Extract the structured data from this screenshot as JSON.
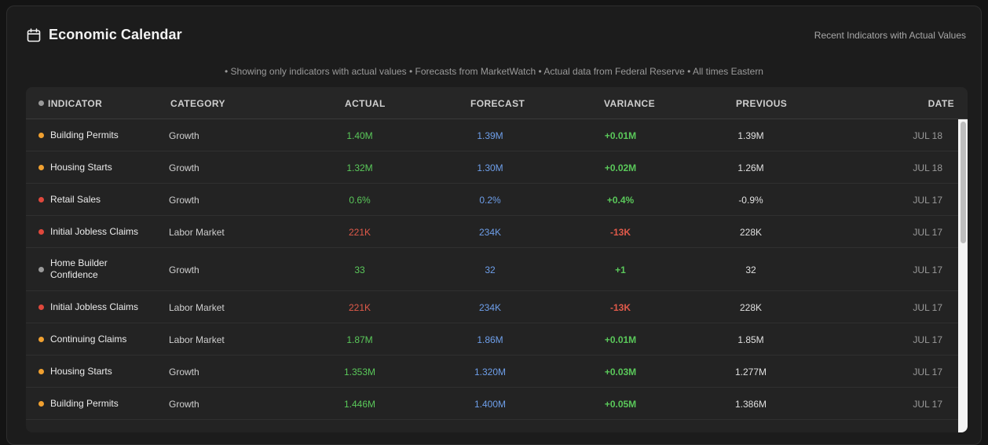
{
  "header": {
    "title": "Economic Calendar",
    "right_text": "Recent Indicators with Actual Values",
    "icon": "calendar-icon"
  },
  "subtitle": "• Showing only indicators with actual values • Forecasts from MarketWatch • Actual data from Federal Reserve • All times Eastern",
  "columns": {
    "indicator": "INDICATOR",
    "category": "CATEGORY",
    "actual": "ACTUAL",
    "forecast": "FORECAST",
    "variance": "VARIANCE",
    "previous": "PREVIOUS",
    "date": "DATE"
  },
  "colors": {
    "positive": "#5ac85a",
    "negative": "#e05a4a",
    "forecast": "#6e9fea",
    "dot_orange": "#f0a030",
    "dot_red": "#e0483c",
    "dot_gray": "#9a9a9a"
  },
  "rows": [
    {
      "indicator": "Building Permits",
      "dot": "orange",
      "category": "Growth",
      "actual": "1.40M",
      "actual_sign": "pos",
      "forecast": "1.39M",
      "variance": "+0.01M",
      "variance_sign": "pos",
      "previous": "1.39M",
      "date": "JUL 18"
    },
    {
      "indicator": "Housing Starts",
      "dot": "orange",
      "category": "Growth",
      "actual": "1.32M",
      "actual_sign": "pos",
      "forecast": "1.30M",
      "variance": "+0.02M",
      "variance_sign": "pos",
      "previous": "1.26M",
      "date": "JUL 18"
    },
    {
      "indicator": "Retail Sales",
      "dot": "red",
      "category": "Growth",
      "actual": "0.6%",
      "actual_sign": "pos",
      "forecast": "0.2%",
      "variance": "+0.4%",
      "variance_sign": "pos",
      "previous": "-0.9%",
      "date": "JUL 17"
    },
    {
      "indicator": "Initial Jobless Claims",
      "dot": "red",
      "category": "Labor Market",
      "actual": "221K",
      "actual_sign": "neg",
      "forecast": "234K",
      "variance": "-13K",
      "variance_sign": "neg",
      "previous": "228K",
      "date": "JUL 17"
    },
    {
      "indicator": "Home Builder Confidence",
      "dot": "gray",
      "category": "Growth",
      "actual": "33",
      "actual_sign": "pos",
      "forecast": "32",
      "variance": "+1",
      "variance_sign": "pos",
      "previous": "32",
      "date": "JUL 17",
      "tall": true
    },
    {
      "indicator": "Initial Jobless Claims",
      "dot": "red",
      "category": "Labor Market",
      "actual": "221K",
      "actual_sign": "neg",
      "forecast": "234K",
      "variance": "-13K",
      "variance_sign": "neg",
      "previous": "228K",
      "date": "JUL 17"
    },
    {
      "indicator": "Continuing Claims",
      "dot": "orange",
      "category": "Labor Market",
      "actual": "1.87M",
      "actual_sign": "pos",
      "forecast": "1.86M",
      "variance": "+0.01M",
      "variance_sign": "pos",
      "previous": "1.85M",
      "date": "JUL 17"
    },
    {
      "indicator": "Housing Starts",
      "dot": "orange",
      "category": "Growth",
      "actual": "1.353M",
      "actual_sign": "pos",
      "forecast": "1.320M",
      "variance": "+0.03M",
      "variance_sign": "pos",
      "previous": "1.277M",
      "date": "JUL 17"
    },
    {
      "indicator": "Building Permits",
      "dot": "orange",
      "category": "Growth",
      "actual": "1.446M",
      "actual_sign": "pos",
      "forecast": "1.400M",
      "variance": "+0.05M",
      "variance_sign": "pos",
      "previous": "1.386M",
      "date": "JUL 17"
    }
  ]
}
